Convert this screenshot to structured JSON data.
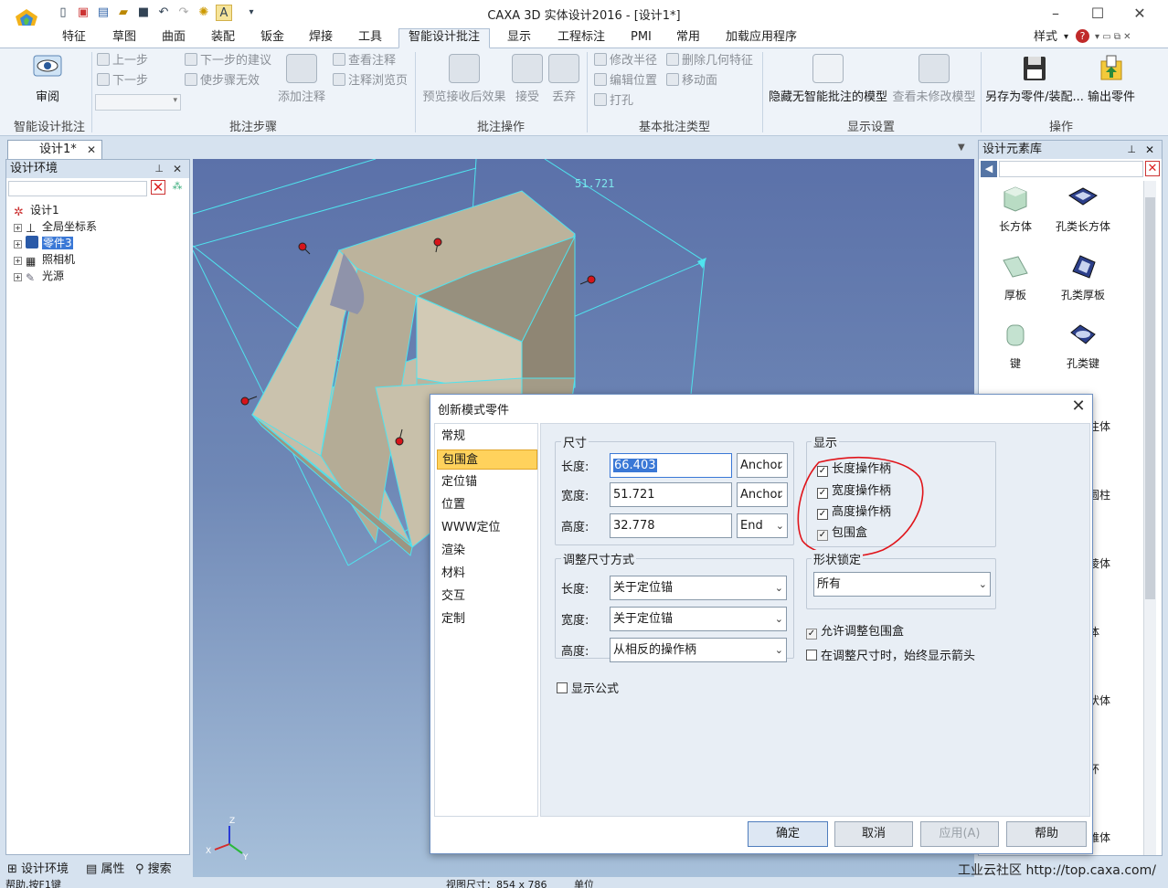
{
  "app": {
    "title": "CAXA 3D 实体设计2016 - [设计1*]",
    "style_label": "样式"
  },
  "tabs": [
    "特征",
    "草图",
    "曲面",
    "装配",
    "钣金",
    "焊接",
    "工具",
    "智能设计批注",
    "显示",
    "工程标注",
    "PMI",
    "常用",
    "加载应用程序"
  ],
  "ribbon": {
    "review": "审阅",
    "group_smart": "智能设计批注",
    "prev_step": "上一步",
    "next_step": "下一步",
    "next_suggest": "下一步的建议",
    "invalidate": "使步骤无效",
    "add_note": "添加注释",
    "view_note": "查看注释",
    "browse_note": "注释浏览页",
    "group_steps": "批注步骤",
    "preview_accept": "预览接收后效果",
    "accept": "接受",
    "discard": "丢弃",
    "group_ops": "批注操作",
    "modify_radius": "修改半径",
    "edit_position": "编辑位置",
    "punch": "打孔",
    "delete_geo": "删除几何特征",
    "move_face": "移动面",
    "group_basic": "基本批注类型",
    "hide_models": "隐藏无智能批注的模型",
    "view_unmodified": "查看未修改模型",
    "group_display": "显示设置",
    "save_as_part": "另存为零件/装配...",
    "export_part": "输出零件",
    "group_action": "操作"
  },
  "doc_tab": "设计1*",
  "left_panel": {
    "title": "设计环境",
    "tree": [
      "设计1",
      "全局坐标系",
      "零件3",
      "照相机",
      "光源"
    ],
    "bottom_tabs": [
      "设计环境",
      "属性",
      "搜索"
    ]
  },
  "viewport": {
    "dimension": "51.721"
  },
  "right_panel": {
    "title": "设计元素库",
    "items": [
      "长方体",
      "孔类长方体",
      "厚板",
      "孔类厚板",
      "键",
      "孔类键"
    ],
    "partial": [
      "注体",
      "圆柱",
      "棱体",
      "体",
      "状体",
      "环",
      "维体"
    ]
  },
  "dialog": {
    "title": "创新模式零件",
    "nav": [
      "常规",
      "包围盒",
      "定位锚",
      "位置",
      "WWW定位",
      "渲染",
      "材料",
      "交互",
      "定制"
    ],
    "size_title": "尺寸",
    "length_label": "长度:",
    "width_label": "宽度:",
    "height_label": "高度:",
    "length_value": "66.403",
    "width_value": "51.721",
    "height_value": "32.778",
    "length_mode": "Anchor",
    "width_mode": "Anchor",
    "height_mode": "End",
    "display_title": "显示",
    "show_length_handle": "长度操作柄",
    "show_width_handle": "宽度操作柄",
    "show_height_handle": "高度操作柄",
    "show_bbox": "包围盒",
    "adjust_title": "调整尺寸方式",
    "adjust_length": "关于定位锚",
    "adjust_width": "关于定位锚",
    "adjust_height": "从相反的操作柄",
    "shape_lock_title": "形状锁定",
    "shape_lock_value": "所有",
    "allow_adjust": "允许调整包围盒",
    "always_arrows": "在调整尺寸时，始终显示箭头",
    "show_formula": "显示公式",
    "ok": "确定",
    "cancel": "取消",
    "apply": "应用(A)",
    "help": "帮助"
  },
  "status": {
    "left": "帮助,按F1键",
    "view_size": "视图尺寸：854 x 786",
    "unit": "单位"
  },
  "watermark": "工业云社区 http://top.caxa.com/",
  "colors": {
    "accent": "#3a78d6",
    "selection": "#ffd25c",
    "annotation": "#e0141a",
    "wireframe": "#4fe3ee"
  }
}
